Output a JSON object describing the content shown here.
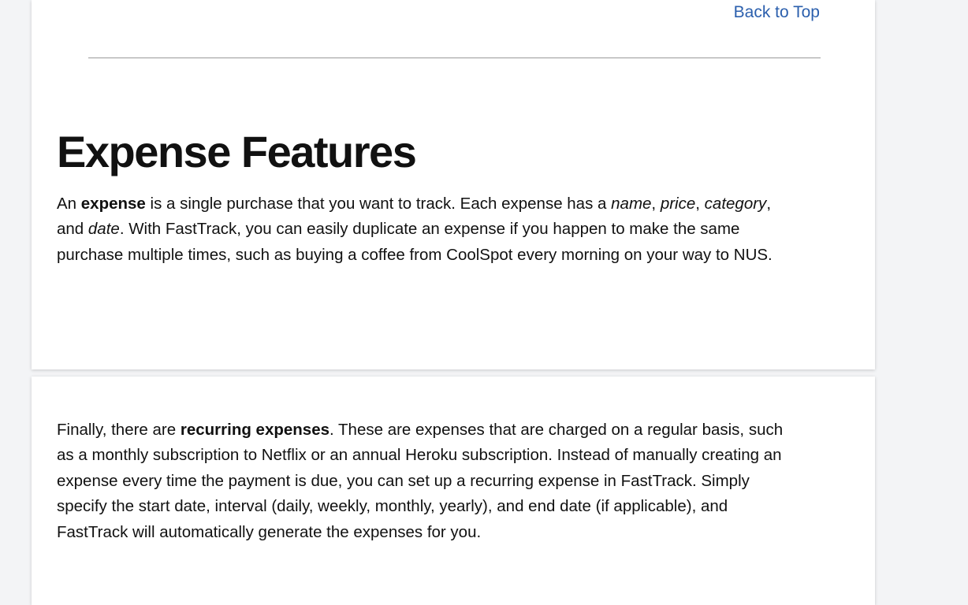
{
  "nav": {
    "back_to_top": "Back to Top"
  },
  "section": {
    "title": "Expense Features"
  },
  "intro": {
    "t1": "An ",
    "b1": "expense",
    "t2": " is a single purchase that you want to track. Each expense has a ",
    "i1": "name",
    "t3": ", ",
    "i2": "price",
    "t4": ", ",
    "i3": "category",
    "t5": ", and ",
    "i4": "date",
    "t6": ". With FastTrack, you can easily duplicate an expense if you happen to make the same purchase multiple times, such as buying a coffee from CoolSpot every morning on your way to NUS."
  },
  "recurring": {
    "t1": "Finally, there are ",
    "b1": "recurring expenses",
    "t2": ". These are expenses that are charged on a regular basis, such as a monthly subscription to Netflix or an annual Heroku subscription. Instead of manually creating an expense every time the payment is due, you can set up a recurring expense in FastTrack. Simply specify the start date, interval (daily, weekly, monthly, yearly), and end date (if applicable), and FastTrack will automatically generate the expenses for you."
  },
  "colors": {
    "link": "#2b5fad",
    "background": "#f3f4f6",
    "page": "#ffffff"
  }
}
